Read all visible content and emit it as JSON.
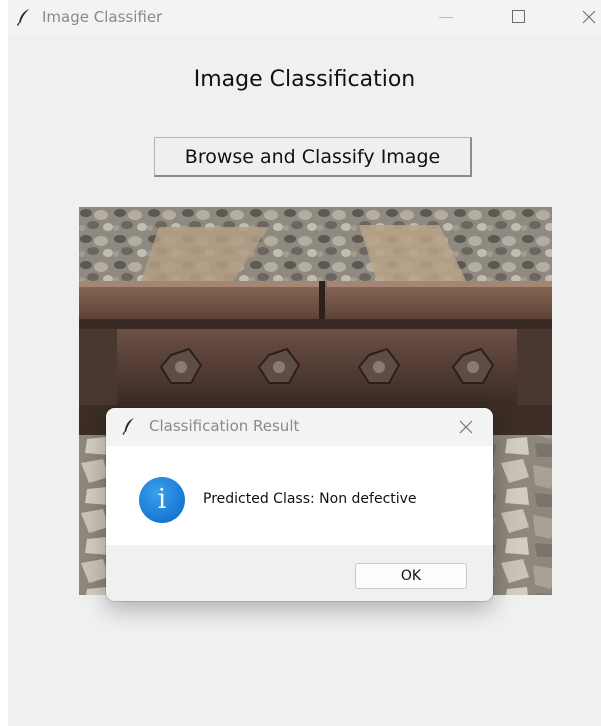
{
  "window": {
    "title": "Image Classifier",
    "heading": "Image Classification",
    "browse_button_label": "Browse and Classify Image"
  },
  "dialog": {
    "title": "Classification Result",
    "message": "Predicted Class: Non defective",
    "info_icon_glyph": "i",
    "ok_label": "OK"
  },
  "icons": {
    "title": "feather-icon",
    "minimize": "minimize-icon",
    "maximize": "maximize-icon",
    "close": "close-icon",
    "dialog_info": "info-icon"
  },
  "colors": {
    "window_bg": "#f0f0f0",
    "titlebar_bg": "#f3f3f3",
    "info_icon": "#1473d4",
    "dialog_bg": "#ffffff"
  }
}
